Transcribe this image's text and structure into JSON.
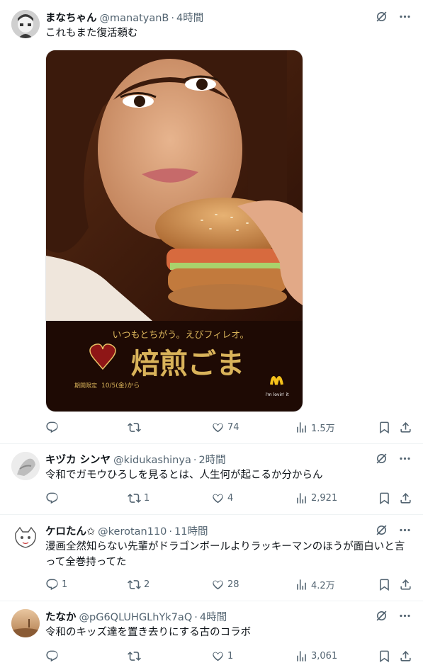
{
  "posts": [
    {
      "author": "まなちゃん",
      "handle": "@manatyanB",
      "dot": "·",
      "time": "4時間",
      "text": "これもまた復活頼む",
      "media": {
        "tagline": "いつもとちがう。えびフィレオ。",
        "product": "焙煎ごま",
        "limited": "期間限定",
        "date": "10/5(金)から",
        "slogan": "i'm lovin' it"
      },
      "stats": {
        "replies": "",
        "reposts": "",
        "likes": "74",
        "views": "1.5万"
      }
    },
    {
      "author": "キヅカ シンヤ",
      "handle": "@kidukashinya",
      "dot": "·",
      "time": "2時間",
      "text": "令和でガモウひろしを見るとは、人生何が起こるか分からん",
      "stats": {
        "replies": "",
        "reposts": "1",
        "likes": "4",
        "views": "2,921"
      }
    },
    {
      "author": "ケロたん✩",
      "handle": "@kerotan110",
      "dot": "·",
      "time": "11時間",
      "text": "漫画全然知らない先輩がドラゴンボールよりラッキーマンのほうが面白いと言って全巻持ってた",
      "stats": {
        "replies": "1",
        "reposts": "2",
        "likes": "28",
        "views": "4.2万"
      }
    },
    {
      "author": "たなか",
      "handle": "@pG6QLUHGLhYk7aQ",
      "dot": "·",
      "time": "4時間",
      "text": "令和のキッズ達を置き去りにする古のコラボ",
      "stats": {
        "replies": "",
        "reposts": "",
        "likes": "1",
        "views": "3,061"
      }
    }
  ],
  "colors": {
    "text": "#0f1419",
    "muted": "#536471",
    "divider": "#eff3f4",
    "gold": "#d9b35a"
  }
}
